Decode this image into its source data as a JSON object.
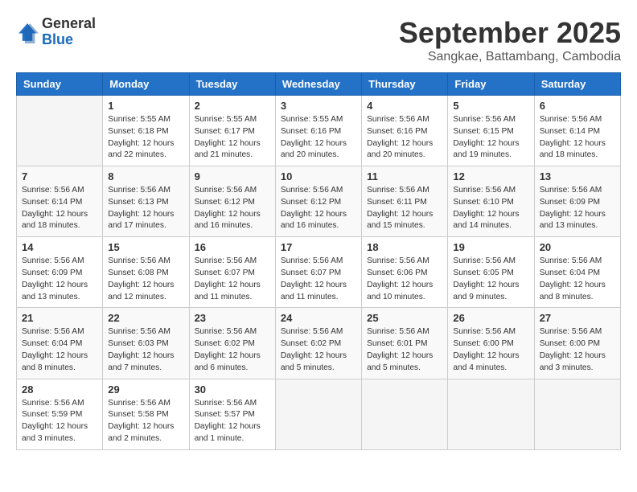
{
  "header": {
    "logo_general": "General",
    "logo_blue": "Blue",
    "month_title": "September 2025",
    "location": "Sangkae, Battambang, Cambodia"
  },
  "days_of_week": [
    "Sunday",
    "Monday",
    "Tuesday",
    "Wednesday",
    "Thursday",
    "Friday",
    "Saturday"
  ],
  "weeks": [
    [
      {
        "num": "",
        "info": ""
      },
      {
        "num": "1",
        "info": "Sunrise: 5:55 AM\nSunset: 6:18 PM\nDaylight: 12 hours\nand 22 minutes."
      },
      {
        "num": "2",
        "info": "Sunrise: 5:55 AM\nSunset: 6:17 PM\nDaylight: 12 hours\nand 21 minutes."
      },
      {
        "num": "3",
        "info": "Sunrise: 5:55 AM\nSunset: 6:16 PM\nDaylight: 12 hours\nand 20 minutes."
      },
      {
        "num": "4",
        "info": "Sunrise: 5:56 AM\nSunset: 6:16 PM\nDaylight: 12 hours\nand 20 minutes."
      },
      {
        "num": "5",
        "info": "Sunrise: 5:56 AM\nSunset: 6:15 PM\nDaylight: 12 hours\nand 19 minutes."
      },
      {
        "num": "6",
        "info": "Sunrise: 5:56 AM\nSunset: 6:14 PM\nDaylight: 12 hours\nand 18 minutes."
      }
    ],
    [
      {
        "num": "7",
        "info": "Sunrise: 5:56 AM\nSunset: 6:14 PM\nDaylight: 12 hours\nand 18 minutes."
      },
      {
        "num": "8",
        "info": "Sunrise: 5:56 AM\nSunset: 6:13 PM\nDaylight: 12 hours\nand 17 minutes."
      },
      {
        "num": "9",
        "info": "Sunrise: 5:56 AM\nSunset: 6:12 PM\nDaylight: 12 hours\nand 16 minutes."
      },
      {
        "num": "10",
        "info": "Sunrise: 5:56 AM\nSunset: 6:12 PM\nDaylight: 12 hours\nand 16 minutes."
      },
      {
        "num": "11",
        "info": "Sunrise: 5:56 AM\nSunset: 6:11 PM\nDaylight: 12 hours\nand 15 minutes."
      },
      {
        "num": "12",
        "info": "Sunrise: 5:56 AM\nSunset: 6:10 PM\nDaylight: 12 hours\nand 14 minutes."
      },
      {
        "num": "13",
        "info": "Sunrise: 5:56 AM\nSunset: 6:09 PM\nDaylight: 12 hours\nand 13 minutes."
      }
    ],
    [
      {
        "num": "14",
        "info": "Sunrise: 5:56 AM\nSunset: 6:09 PM\nDaylight: 12 hours\nand 13 minutes."
      },
      {
        "num": "15",
        "info": "Sunrise: 5:56 AM\nSunset: 6:08 PM\nDaylight: 12 hours\nand 12 minutes."
      },
      {
        "num": "16",
        "info": "Sunrise: 5:56 AM\nSunset: 6:07 PM\nDaylight: 12 hours\nand 11 minutes."
      },
      {
        "num": "17",
        "info": "Sunrise: 5:56 AM\nSunset: 6:07 PM\nDaylight: 12 hours\nand 11 minutes."
      },
      {
        "num": "18",
        "info": "Sunrise: 5:56 AM\nSunset: 6:06 PM\nDaylight: 12 hours\nand 10 minutes."
      },
      {
        "num": "19",
        "info": "Sunrise: 5:56 AM\nSunset: 6:05 PM\nDaylight: 12 hours\nand 9 minutes."
      },
      {
        "num": "20",
        "info": "Sunrise: 5:56 AM\nSunset: 6:04 PM\nDaylight: 12 hours\nand 8 minutes."
      }
    ],
    [
      {
        "num": "21",
        "info": "Sunrise: 5:56 AM\nSunset: 6:04 PM\nDaylight: 12 hours\nand 8 minutes."
      },
      {
        "num": "22",
        "info": "Sunrise: 5:56 AM\nSunset: 6:03 PM\nDaylight: 12 hours\nand 7 minutes."
      },
      {
        "num": "23",
        "info": "Sunrise: 5:56 AM\nSunset: 6:02 PM\nDaylight: 12 hours\nand 6 minutes."
      },
      {
        "num": "24",
        "info": "Sunrise: 5:56 AM\nSunset: 6:02 PM\nDaylight: 12 hours\nand 5 minutes."
      },
      {
        "num": "25",
        "info": "Sunrise: 5:56 AM\nSunset: 6:01 PM\nDaylight: 12 hours\nand 5 minutes."
      },
      {
        "num": "26",
        "info": "Sunrise: 5:56 AM\nSunset: 6:00 PM\nDaylight: 12 hours\nand 4 minutes."
      },
      {
        "num": "27",
        "info": "Sunrise: 5:56 AM\nSunset: 6:00 PM\nDaylight: 12 hours\nand 3 minutes."
      }
    ],
    [
      {
        "num": "28",
        "info": "Sunrise: 5:56 AM\nSunset: 5:59 PM\nDaylight: 12 hours\nand 3 minutes."
      },
      {
        "num": "29",
        "info": "Sunrise: 5:56 AM\nSunset: 5:58 PM\nDaylight: 12 hours\nand 2 minutes."
      },
      {
        "num": "30",
        "info": "Sunrise: 5:56 AM\nSunset: 5:57 PM\nDaylight: 12 hours\nand 1 minute."
      },
      {
        "num": "",
        "info": ""
      },
      {
        "num": "",
        "info": ""
      },
      {
        "num": "",
        "info": ""
      },
      {
        "num": "",
        "info": ""
      }
    ]
  ]
}
